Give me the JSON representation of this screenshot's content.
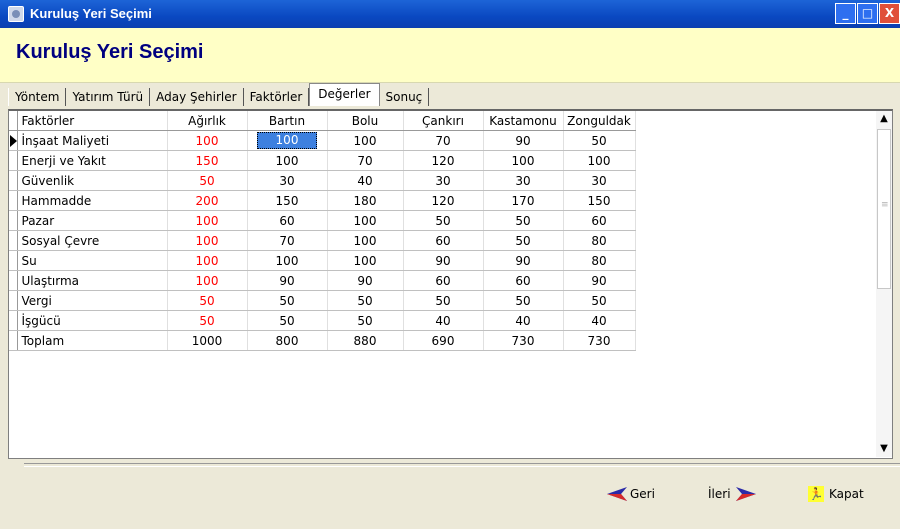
{
  "window": {
    "title": "Kuruluş Yeri Seçimi",
    "controls": [
      "_",
      "□",
      "X"
    ]
  },
  "header": {
    "title": "Kuruluş Yeri Seçimi"
  },
  "tabs": [
    {
      "label": "Yöntem",
      "active": false
    },
    {
      "label": "Yatırım Türü",
      "active": false
    },
    {
      "label": "Aday Şehirler",
      "active": false
    },
    {
      "label": "Faktörler",
      "active": false
    },
    {
      "label": "Değerler",
      "active": true
    },
    {
      "label": "Sonuç",
      "active": false
    }
  ],
  "grid": {
    "columns": [
      "Faktörler",
      "Ağırlık",
      "Bartın",
      "Bolu",
      "Çankırı",
      "Kastamonu",
      "Zonguldak"
    ],
    "rows": [
      [
        "İnşaat Maliyeti",
        "100",
        "100",
        "100",
        "70",
        "90",
        "50"
      ],
      [
        "Enerji ve Yakıt",
        "150",
        "100",
        "70",
        "120",
        "100",
        "100"
      ],
      [
        "Güvenlik",
        "50",
        "30",
        "40",
        "30",
        "30",
        "30"
      ],
      [
        "Hammadde",
        "200",
        "150",
        "180",
        "120",
        "170",
        "150"
      ],
      [
        "Pazar",
        "100",
        "60",
        "100",
        "50",
        "50",
        "60"
      ],
      [
        "Sosyal Çevre",
        "100",
        "70",
        "100",
        "60",
        "50",
        "80"
      ],
      [
        "Su",
        "100",
        "100",
        "100",
        "90",
        "90",
        "80"
      ],
      [
        "Ulaştırma",
        "100",
        "90",
        "90",
        "60",
        "60",
        "90"
      ],
      [
        "Vergi",
        "50",
        "50",
        "50",
        "50",
        "50",
        "50"
      ],
      [
        "İşgücü",
        "50",
        "50",
        "50",
        "40",
        "40",
        "40"
      ],
      [
        "Toplam",
        "1000",
        "800",
        "880",
        "690",
        "730",
        "730"
      ]
    ],
    "current_row": 0,
    "selected_cell": {
      "row": 0,
      "col": 2
    },
    "weight_color": "#ff0000",
    "selection_color": "#3d80df"
  },
  "footer": {
    "back_label": "Geri",
    "next_label": "İleri",
    "close_label": "Kapat",
    "back_icon": "arrow-left-icon",
    "next_icon": "arrow-right-icon",
    "close_icon": "running-man-icon"
  }
}
